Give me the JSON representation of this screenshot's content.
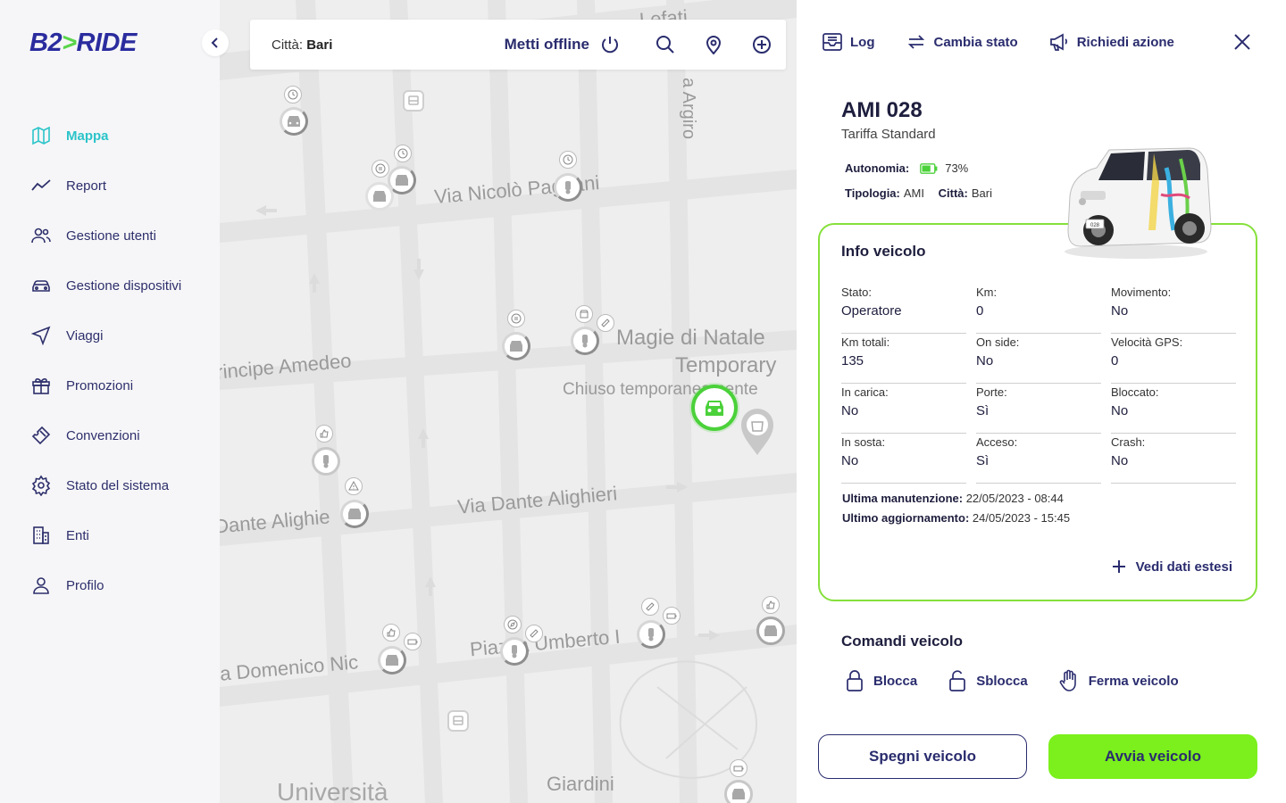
{
  "app": {
    "logo_text_a": "B2",
    "logo_arrow": ">",
    "logo_text_b": "RIDE"
  },
  "colors": {
    "accent": "#2bc4c9",
    "brand_navy": "#2a2c6e",
    "green": "#7bf01c",
    "card_border": "#86e03b"
  },
  "sidebar": {
    "items": [
      {
        "label": "Mappa",
        "icon": "map-icon",
        "active": true
      },
      {
        "label": "Report",
        "icon": "chart-line-icon"
      },
      {
        "label": "Gestione utenti",
        "icon": "users-icon"
      },
      {
        "label": "Gestione dispositivi",
        "icon": "car-icon"
      },
      {
        "label": "Viaggi",
        "icon": "navigation-icon"
      },
      {
        "label": "Promozioni",
        "icon": "gift-icon"
      },
      {
        "label": "Convenzioni",
        "icon": "ticket-icon"
      },
      {
        "label": "Stato del sistema",
        "icon": "gear-icon"
      },
      {
        "label": "Enti",
        "icon": "building-icon"
      },
      {
        "label": "Profilo",
        "icon": "user-icon"
      }
    ]
  },
  "map": {
    "city_label": "Città:",
    "city_value": "Bari",
    "offline_label": "Metti offline",
    "streets": {
      "s1": "Via Nicolò Pagnani",
      "s2": "rincipe Amedeo",
      "s3": "Via Dante Alighieri",
      "s4": "Dante Alighie",
      "s5": "a Domenico Nic",
      "s6": "Piazza Umberto I",
      "s7": "Magie di Natale",
      "s8": "Temporary",
      "s9": "Chiuso temporaneamente",
      "s10": "Giardini",
      "s11": "Università",
      "s12": "a Argiro",
      "s13": "Lefati"
    }
  },
  "panel": {
    "log_label": "Log",
    "change_state_label": "Cambia stato",
    "request_action_label": "Richiedi azione",
    "vehicle_name": "AMI 028",
    "tariff": "Tariffa Standard",
    "autonomy_label": "Autonomia:",
    "autonomy_value": "73%",
    "autonomy_fraction": 0.73,
    "type_label": "Tipologia:",
    "type_value": "AMI",
    "city_label": "Città:",
    "city_value": "Bari",
    "info_title": "Info veicolo",
    "fields": [
      {
        "k": "Stato:",
        "v": "Operatore"
      },
      {
        "k": "Km:",
        "v": "0"
      },
      {
        "k": "Movimento:",
        "v": "No"
      },
      {
        "k": "Km totali:",
        "v": "135"
      },
      {
        "k": "On side:",
        "v": "No"
      },
      {
        "k": "Velocità GPS:",
        "v": "0"
      },
      {
        "k": "In carica:",
        "v": "No"
      },
      {
        "k": "Porte:",
        "v": "Sì"
      },
      {
        "k": "Bloccato:",
        "v": "No"
      },
      {
        "k": "In sosta:",
        "v": "No"
      },
      {
        "k": "Acceso:",
        "v": "Sì"
      },
      {
        "k": "Crash:",
        "v": "No"
      }
    ],
    "last_maintenance_label": "Ultima manutenzione:",
    "last_maintenance_value": "22/05/2023 - 08:44",
    "last_update_label": "Ultimo aggiornamento:",
    "last_update_value": "24/05/2023 - 15:45",
    "extended_label": "Vedi dati estesi",
    "commands_title": "Comandi veicolo",
    "lock_label": "Blocca",
    "unlock_label": "Sblocca",
    "stop_label": "Ferma veicolo",
    "turn_off_label": "Spegni veicolo",
    "start_label": "Avvia veicolo",
    "car_plate": "028"
  }
}
